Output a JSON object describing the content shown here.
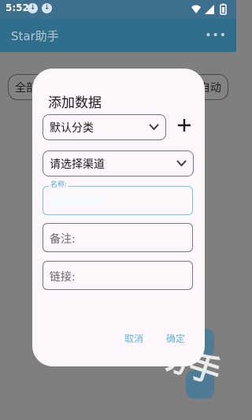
{
  "status_bar": {
    "time": "5:52",
    "download_icon": "↓"
  },
  "app_bar": {
    "title": "Star助手",
    "menu": "•••"
  },
  "background": {
    "chip_left": "全部",
    "chip_right": "自动",
    "watermark": "助手"
  },
  "dialog": {
    "title": "添加数据",
    "category": {
      "selected": "默认分类"
    },
    "add_icon": "+",
    "channel": {
      "placeholder": "请选择渠道"
    },
    "name_field": {
      "label": "名称:",
      "value": ""
    },
    "remark_field": {
      "placeholder": "备注:"
    },
    "link_field": {
      "placeholder": "链接:"
    },
    "cancel_label": "取消",
    "confirm_label": "确定"
  },
  "colors": {
    "accent": "#61b3dc",
    "focus": "#6ec6e6",
    "scrim": "#7f7f7f",
    "dialog_bg": "#fdf7fb",
    "appbar": "#2f6f8b"
  }
}
